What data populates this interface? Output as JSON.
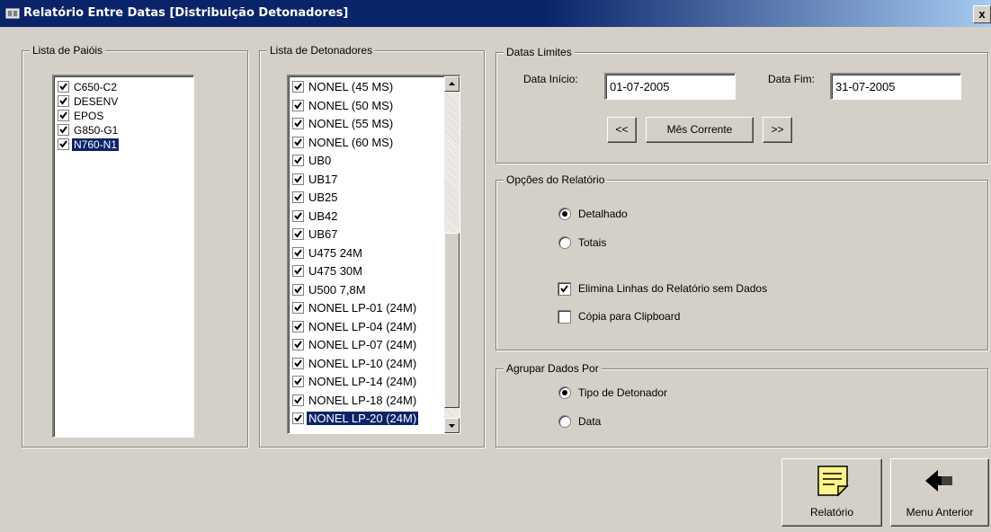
{
  "window": {
    "title": "Relatório Entre Datas [Distribuição Detonadores]",
    "close_label": "x"
  },
  "paiois": {
    "legend": "Lista de Paióis",
    "items": [
      {
        "label": "C650-C2",
        "checked": true
      },
      {
        "label": "DESENV",
        "checked": true
      },
      {
        "label": "EPOS",
        "checked": true
      },
      {
        "label": "G850-G1",
        "checked": true
      },
      {
        "label": "N760-N1",
        "checked": true
      }
    ]
  },
  "detonadores": {
    "legend": "Lista de Detonadores",
    "items": [
      {
        "label": "NONEL (45 MS)",
        "checked": true
      },
      {
        "label": "NONEL (50 MS)",
        "checked": true
      },
      {
        "label": "NONEL (55 MS)",
        "checked": true
      },
      {
        "label": "NONEL (60 MS)",
        "checked": true
      },
      {
        "label": "UB0",
        "checked": true
      },
      {
        "label": "UB17",
        "checked": true
      },
      {
        "label": "UB25",
        "checked": true
      },
      {
        "label": "UB42",
        "checked": true
      },
      {
        "label": "UB67",
        "checked": true
      },
      {
        "label": "U475 24M",
        "checked": true
      },
      {
        "label": "U475 30M",
        "checked": true
      },
      {
        "label": "U500 7,8M",
        "checked": true
      },
      {
        "label": "NONEL LP-01 (24M)",
        "checked": true
      },
      {
        "label": "NONEL LP-04 (24M)",
        "checked": true
      },
      {
        "label": "NONEL LP-07 (24M)",
        "checked": true
      },
      {
        "label": "NONEL LP-10 (24M)",
        "checked": true
      },
      {
        "label": "NONEL LP-14 (24M)",
        "checked": true
      },
      {
        "label": "NONEL LP-18 (24M)",
        "checked": true
      },
      {
        "label": "NONEL LP-20 (24M)",
        "checked": true
      }
    ]
  },
  "datas": {
    "legend": "Datas Limites",
    "inicio_label": "Data Início:",
    "inicio_value": "01-07-2005",
    "fim_label": "Data Fim:",
    "fim_value": "31-07-2005",
    "prev_label": "<<",
    "current_label": "Mês Corrente",
    "next_label": ">>"
  },
  "opcoes": {
    "legend": "Opções do Relatório",
    "detalhado_label": "Detalhado",
    "totais_label": "Totais",
    "selected": "Detalhado",
    "elimina_label": "Elimina Linhas do Relatório sem Dados",
    "elimina_checked": true,
    "copia_label": "Cópia para Clipboard",
    "copia_checked": false
  },
  "agrupar": {
    "legend": "Agrupar Dados Por",
    "tipo_label": "Tipo de Detonador",
    "data_label": "Data",
    "selected": "Tipo de Detonador"
  },
  "buttons": {
    "relatorio_label": "Relatório",
    "menu_label": "Menu Anterior"
  }
}
